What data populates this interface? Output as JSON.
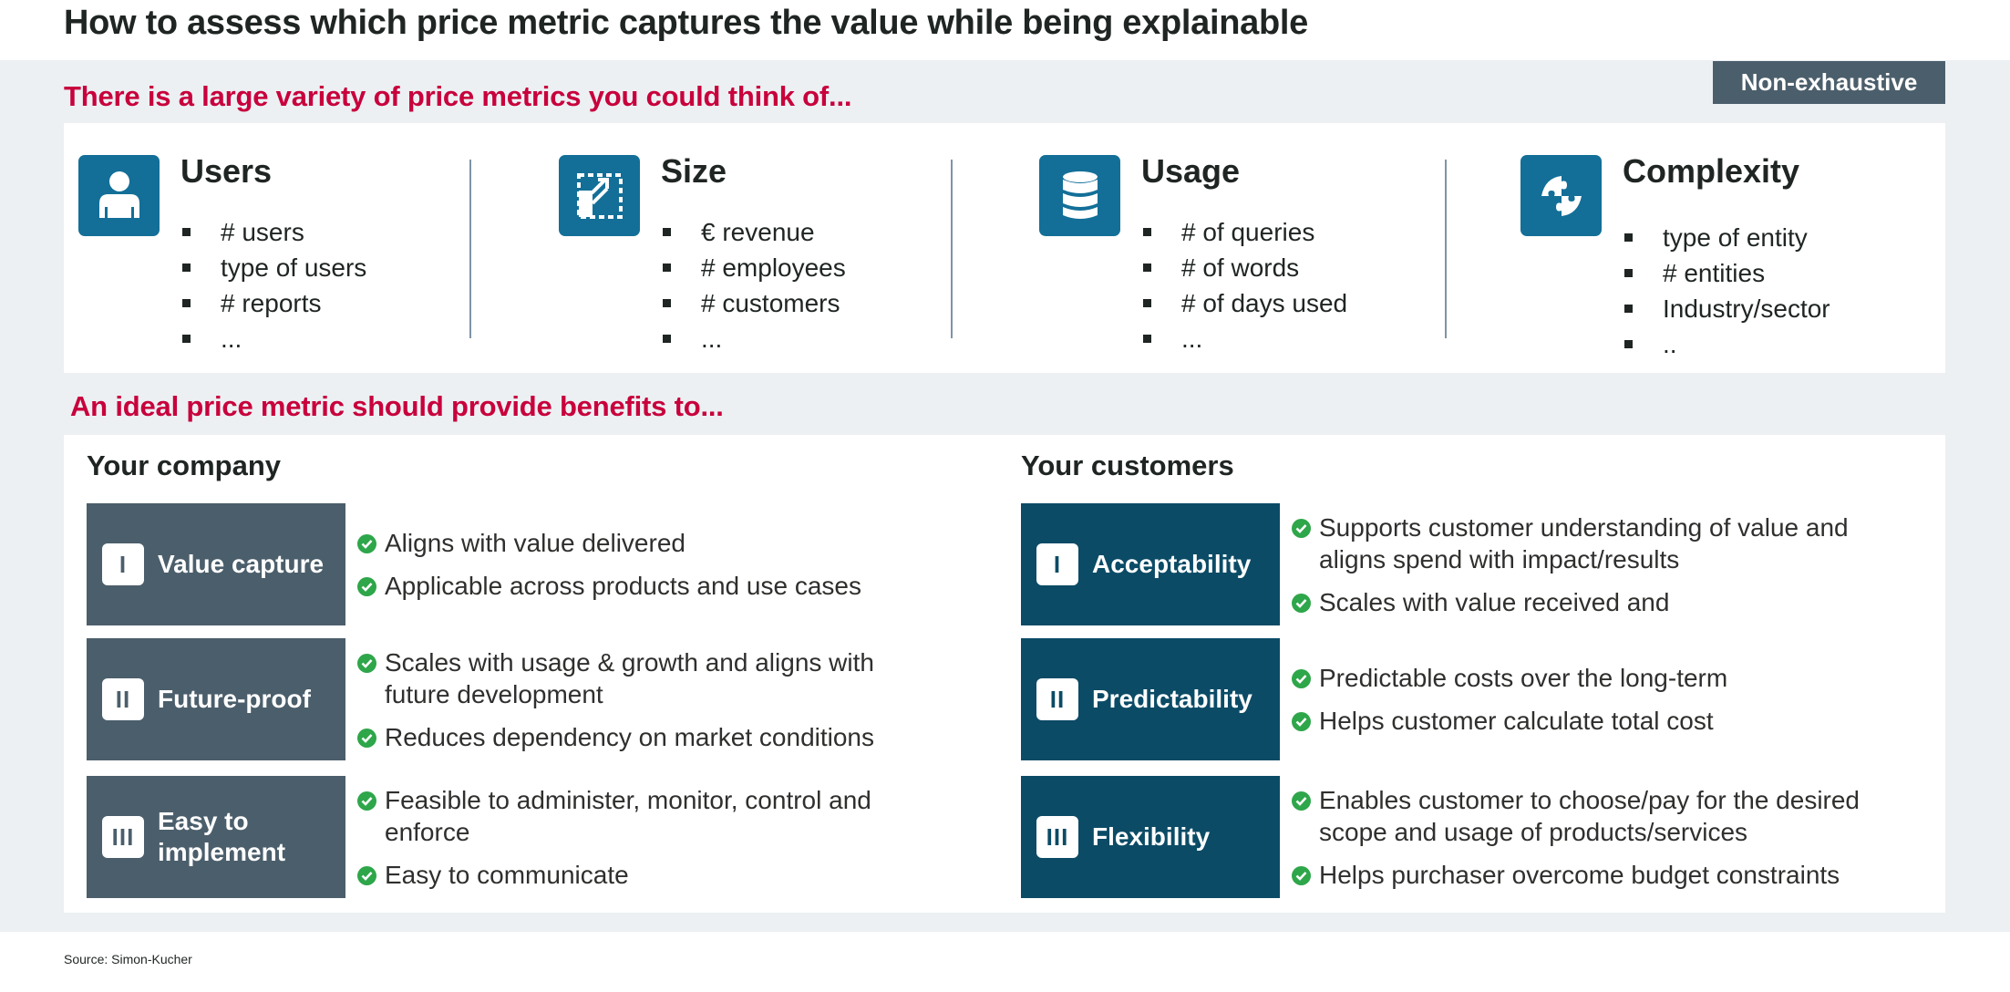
{
  "title": "How to assess which price metric captures the value while being explainable",
  "badge": "Non-exhaustive",
  "section1": {
    "heading": "There is a large variety of price metrics you could think of...",
    "metrics": [
      {
        "icon": "user-icon",
        "title": "Users",
        "items": [
          "# users",
          "type of users",
          "# reports",
          "..."
        ]
      },
      {
        "icon": "resize-icon",
        "title": "Size",
        "items": [
          "€ revenue",
          "# employees",
          "# customers",
          "..."
        ]
      },
      {
        "icon": "database-icon",
        "title": "Usage",
        "items": [
          "# of queries",
          "# of words",
          "# of days used",
          "..."
        ]
      },
      {
        "icon": "puzzle-icon",
        "title": "Complexity",
        "items": [
          "type of entity",
          "# entities",
          "Industry/sector",
          ".."
        ]
      }
    ]
  },
  "section2": {
    "heading": "An ideal price metric should provide benefits to...",
    "company": {
      "title": "Your company",
      "criteria": [
        {
          "numeral": "I",
          "label": "Value capture",
          "benefits": [
            "Aligns with value delivered",
            "Applicable across products and use cases"
          ]
        },
        {
          "numeral": "II",
          "label": "Future-proof",
          "benefits": [
            "Scales with usage & growth and aligns with future development",
            "Reduces dependency on market conditions"
          ]
        },
        {
          "numeral": "III",
          "label": "Easy to implement",
          "benefits": [
            "Feasible to administer, monitor, control and enforce",
            "Easy to communicate"
          ]
        }
      ]
    },
    "customers": {
      "title": "Your customers",
      "criteria": [
        {
          "numeral": "I",
          "label": "Acceptability",
          "benefits": [
            "Supports customer understanding of value and aligns spend with impact/results",
            "Scales with value received and"
          ]
        },
        {
          "numeral": "II",
          "label": "Predictability",
          "benefits": [
            "Predictable costs over the long-term",
            "Helps customer calculate total cost"
          ]
        },
        {
          "numeral": "III",
          "label": "Flexibility",
          "benefits": [
            "Enables customer to choose/pay for the desired scope and usage of products/services",
            "Helps purchaser overcome budget constraints"
          ]
        }
      ]
    }
  },
  "source": "Source: Simon-Kucher",
  "colors": {
    "accent_red": "#c8003c",
    "icon_blue": "#136f98",
    "company_box": "#4b5e6b",
    "customer_box": "#0b4b66",
    "check_green": "#2ea64a",
    "band_gray": "#ecf0f3"
  }
}
